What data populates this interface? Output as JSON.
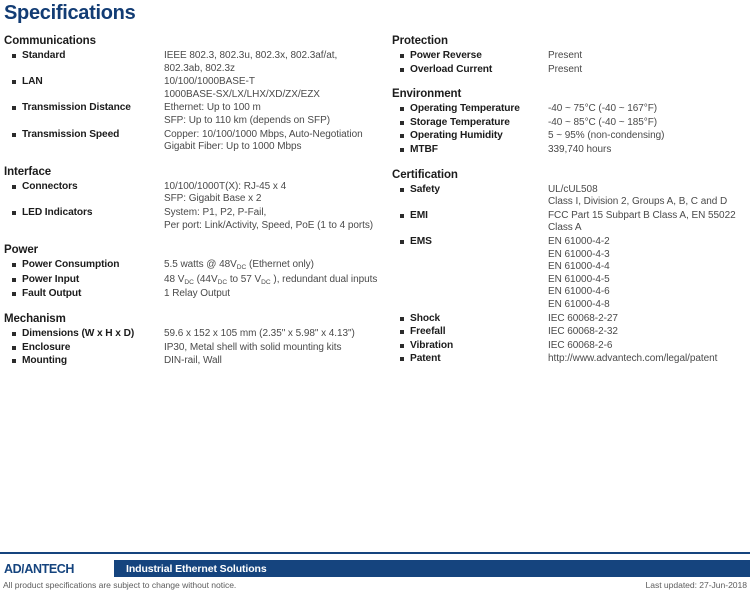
{
  "page": {
    "title": "Specifications"
  },
  "left_column": [
    {
      "id": "communications",
      "title": "Communications",
      "rows": [
        {
          "label": "Standard",
          "values": [
            "IEEE 802.3, 802.3u, 802.3x, 802.3af/at,",
            "802.3ab, 802.3z"
          ]
        },
        {
          "label": "LAN",
          "values": [
            "10/100/1000BASE-T",
            "1000BASE-SX/LX/LHX/XD/ZX/EZX"
          ]
        },
        {
          "label": "Transmission Distance",
          "values": [
            "Ethernet: Up to 100 m",
            "SFP: Up to 110 km (depends on SFP)"
          ]
        },
        {
          "label": "Transmission Speed",
          "values": [
            "Copper: 10/100/1000 Mbps, Auto-Negotiation",
            "Gigabit Fiber: Up to 1000 Mbps"
          ]
        }
      ]
    },
    {
      "id": "interface",
      "title": "Interface",
      "rows": [
        {
          "label": "Connectors",
          "values": [
            "10/100/1000T(X): RJ-45 x 4",
            "SFP: Gigabit Base x 2"
          ]
        },
        {
          "label": "LED Indicators",
          "values": [
            "System: P1, P2, P-Fail,",
            "Per port: Link/Activity, Speed, PoE (1 to 4 ports)"
          ]
        }
      ]
    },
    {
      "id": "power",
      "title": "Power",
      "rows": [
        {
          "label": "Power Consumption",
          "values": [
            "5.5 watts @ 48V<sub class=\"dc\">DC</sub>  (Ethernet only)"
          ],
          "html": true
        },
        {
          "label": "Power Input",
          "values": [
            "48 V<sub class=\"dc\">DC</sub> (44V<sub class=\"dc\">DC</sub> to 57 V<sub class=\"dc\">DC</sub> ), redundant dual inputs"
          ],
          "html": true
        },
        {
          "label": "Fault Output",
          "values": [
            "1 Relay Output"
          ]
        }
      ]
    },
    {
      "id": "mechanism",
      "title": "Mechanism",
      "rows": [
        {
          "label": "Dimensions (W x H x D)",
          "values": [
            "59.6 x 152 x 105 mm (2.35\" x 5.98\" x 4.13\")"
          ]
        },
        {
          "label": "Enclosure",
          "values": [
            "IP30, Metal shell with solid mounting kits"
          ]
        },
        {
          "label": "Mounting",
          "values": [
            "DIN-rail, Wall"
          ]
        }
      ]
    }
  ],
  "right_column": [
    {
      "id": "protection",
      "title": "Protection",
      "rows": [
        {
          "label": "Power Reverse",
          "values": [
            "Present"
          ]
        },
        {
          "label": "Overload Current",
          "values": [
            "Present"
          ]
        }
      ]
    },
    {
      "id": "environment",
      "title": "Environment",
      "rows": [
        {
          "label": "Operating Temperature",
          "values": [
            "-40 ~ 75°C  (-40 ~ 167°F)"
          ]
        },
        {
          "label": "Storage Temperature",
          "values": [
            "-40 ~ 85°C  (-40 ~ 185°F)"
          ]
        },
        {
          "label": "Operating Humidity",
          "values": [
            "5 ~ 95% (non-condensing)"
          ]
        },
        {
          "label": "MTBF",
          "values": [
            "339,740 hours"
          ]
        }
      ]
    },
    {
      "id": "certification",
      "title": "Certification",
      "rows": [
        {
          "label": "Safety",
          "values": [
            "UL/cUL508",
            "Class I, Division 2, Groups A, B, C and D"
          ]
        },
        {
          "label": "EMI",
          "values": [
            "FCC Part 15 Subpart B Class A,  EN 55022",
            "Class A"
          ]
        },
        {
          "label": "EMS",
          "values": [
            "EN 61000-4-2",
            "EN 61000-4-3",
            "EN 61000-4-4",
            "EN 61000-4-5",
            "EN 61000-4-6",
            "EN 61000-4-8"
          ]
        },
        {
          "label": "Shock",
          "values": [
            "IEC 60068-2-27"
          ]
        },
        {
          "label": "Freefall",
          "values": [
            "IEC 60068-2-32"
          ]
        },
        {
          "label": "Vibration",
          "values": [
            "IEC 60068-2-6"
          ]
        },
        {
          "label": "Patent",
          "values": [
            "http://www.advantech.com/legal/patent"
          ]
        }
      ]
    }
  ],
  "footer": {
    "logo_pre": "AD",
    "logo_slash": "\\",
    "logo_post": "ANTECH",
    "tagline": "Industrial Ethernet Solutions",
    "disclaimer": "All product specifications are subject to change without notice.",
    "last_updated": "Last updated: 27-Jun-2018",
    "bar_color": "#15447e",
    "title_color": "#123c74"
  }
}
